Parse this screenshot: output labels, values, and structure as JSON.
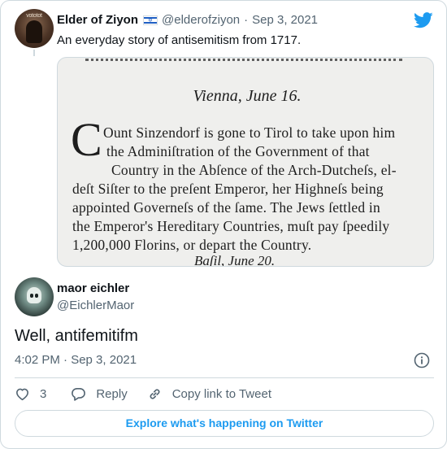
{
  "quoted_tweet": {
    "avatar_text": "vototot",
    "name": "Elder of Ziyon",
    "handle": "@elderofziyon",
    "separator": "·",
    "date": "Sep 3, 2021",
    "text": "An everyday story of antisemitism from 1717.",
    "image": {
      "dateline": "Vienna, June 16.",
      "dropcap": "C",
      "lines": [
        "Ount Sinzendorf is gone to Tirol to take upon him",
        "the Adminiſtration of the Government of that",
        "Country in the Abſence of the Arch-Dutcheſs, el-",
        "deſt Siſter to the preſent Emperor, her Highneſs being",
        "appointed Governeſs of the ſame.  The Jews ſettled in",
        "the Emperor's Hereditary Countries, muſt pay ſpeedily",
        "1,200,000 Florins, or depart the Country."
      ],
      "footer": "Baſil, June 20."
    }
  },
  "reply_tweet": {
    "name": "maor eichler",
    "handle": "@EichlerMaor",
    "text": "Well, antifemitifm",
    "timestamp": "4:02 PM · Sep 3, 2021"
  },
  "actions": {
    "likes": "3",
    "reply_label": "Reply",
    "copy_link_label": "Copy link to Tweet"
  },
  "explore_label": "Explore what's happening on Twitter",
  "icons": {
    "brand": "twitter-bird-icon",
    "info": "info-icon",
    "like": "heart-icon",
    "reply": "speech-bubble-icon",
    "copy": "link-icon"
  },
  "colors": {
    "accent": "#1d9bf0",
    "text": "#0f1419",
    "secondary": "#536471",
    "border": "#cfd9de"
  }
}
